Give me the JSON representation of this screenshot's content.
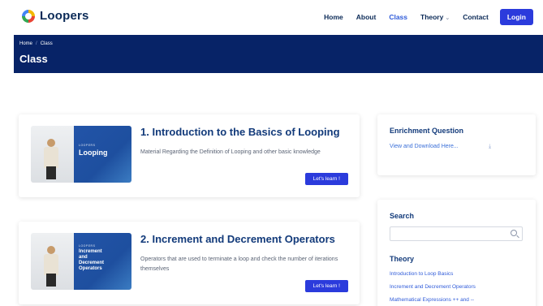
{
  "brand": {
    "name": "Loopers"
  },
  "nav": {
    "items": [
      {
        "label": "Home",
        "active": false
      },
      {
        "label": "About",
        "active": false
      },
      {
        "label": "Class",
        "active": true
      },
      {
        "label": "Theory",
        "active": false,
        "dropdown": true
      },
      {
        "label": "Contact",
        "active": false
      }
    ],
    "login_label": "Login"
  },
  "header": {
    "breadcrumb": [
      "Home",
      "Class"
    ],
    "breadcrumb_sep": "/",
    "title": "Class"
  },
  "courses": [
    {
      "thumb_small": "LOOPERS",
      "thumb_title": "Looping",
      "title": "1. Introduction to the Basics of Looping",
      "description": "Material Regarding the Definition of Looping and other basic knowledge",
      "button_label": "Let's learn !"
    },
    {
      "thumb_small": "LOOPERS",
      "thumb_title_lines": [
        "Increment",
        "and",
        "Decrement",
        "Operators"
      ],
      "title": "2. Increment and Decrement Operators",
      "description": "Operators that are used to terminate a loop and check the number of iterations themselves",
      "button_label": "Let's learn !"
    }
  ],
  "sidebar": {
    "enrichment": {
      "title": "Enrichment Question",
      "link_label": "View and Download Here...",
      "icon": "download-icon"
    },
    "search": {
      "title": "Search",
      "placeholder": ""
    },
    "theory": {
      "title": "Theory",
      "items": [
        "Introduction to Loop Basics",
        "Increment and Decrement Operators",
        "Mathematical Expressions ++ and --"
      ]
    }
  },
  "colors": {
    "primary": "#2b3bdc",
    "header_bg": "#072367",
    "heading": "#123a7a",
    "link": "#2f5bd9"
  }
}
